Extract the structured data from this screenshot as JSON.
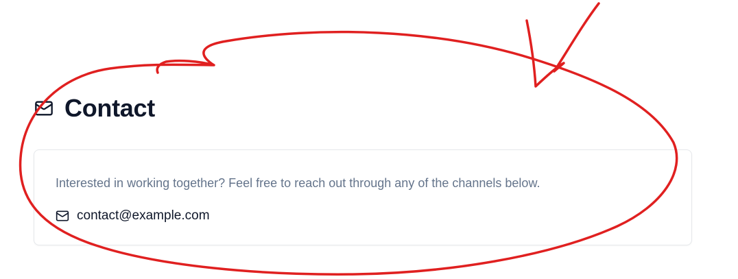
{
  "contact": {
    "title": "Contact",
    "header_icon": "mail-icon",
    "description": "Interested in working together? Feel free to reach out through any of the channels below.",
    "email": {
      "icon": "mail-icon",
      "address": "contact@example.com"
    }
  },
  "colors": {
    "title": "#0f172a",
    "body_text": "#64748b",
    "card_border": "#e5e7eb",
    "annotation_stroke": "#e02020"
  }
}
